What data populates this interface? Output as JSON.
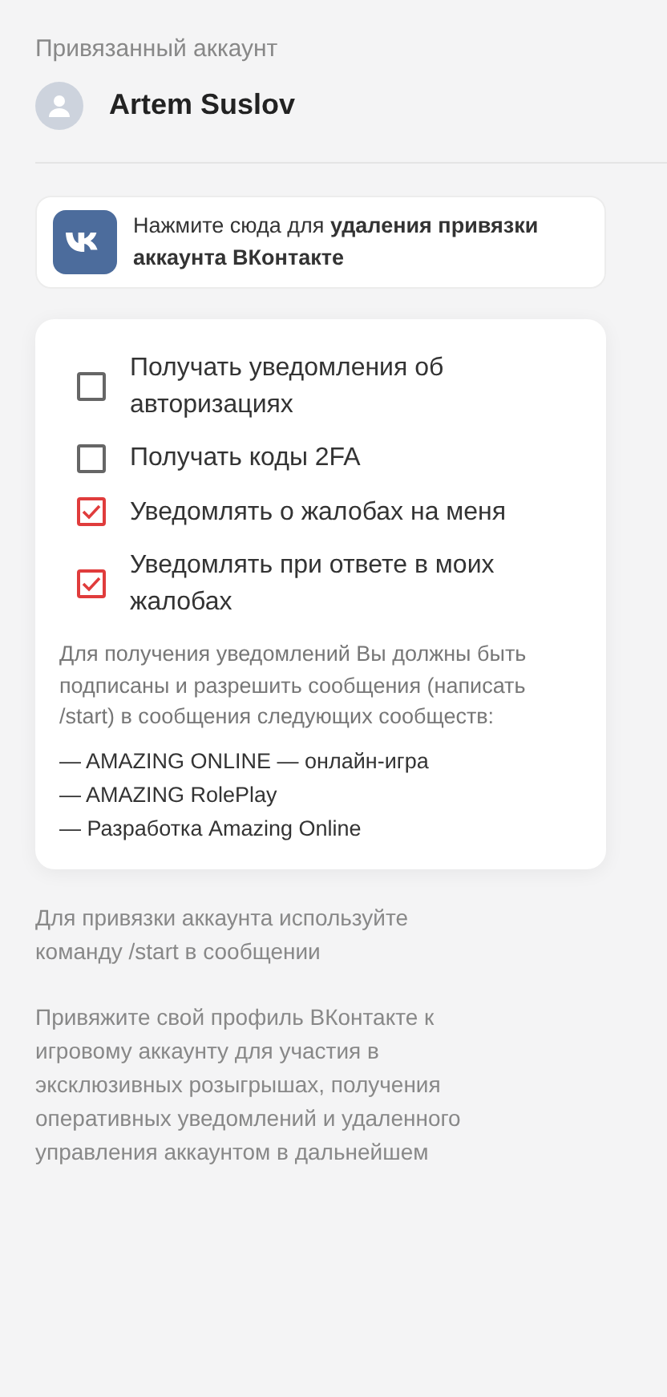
{
  "linked_account": {
    "heading": "Привязанный аккаунт",
    "name": "Artem Suslov"
  },
  "vk_unlink": {
    "text": "Нажмите сюда для **удаления привязки аккаунта ВКонтакте**"
  },
  "options": [
    {
      "label": "Получать уведомления об авторизациях",
      "checked": false
    },
    {
      "label": "Получать коды 2FA",
      "checked": false
    },
    {
      "label": "Уведомлять о жалобах на меня",
      "checked": true
    },
    {
      "label": "Уведомлять при ответе в моих жалобах",
      "checked": true
    }
  ],
  "note": "Для получения уведомлений Вы должны быть подписаны и разрешить сообщения (написать /start) в сообщения следующих сообществ:",
  "communities": [
    "— AMAZING ONLINE — онлайн-игра",
    "— AMAZING RolePlay",
    "— Разработка Amazing Online"
  ],
  "footer": [
    "Для привязки аккаунта используйте команду /start в сообщении",
    "Привяжите свой профиль ВКонтакте к игровому аккаунту для участия в эксклюзивных розыгрышах, получения оперативных уведомлений и удаленного управления аккаунтом в дальнейшем"
  ]
}
